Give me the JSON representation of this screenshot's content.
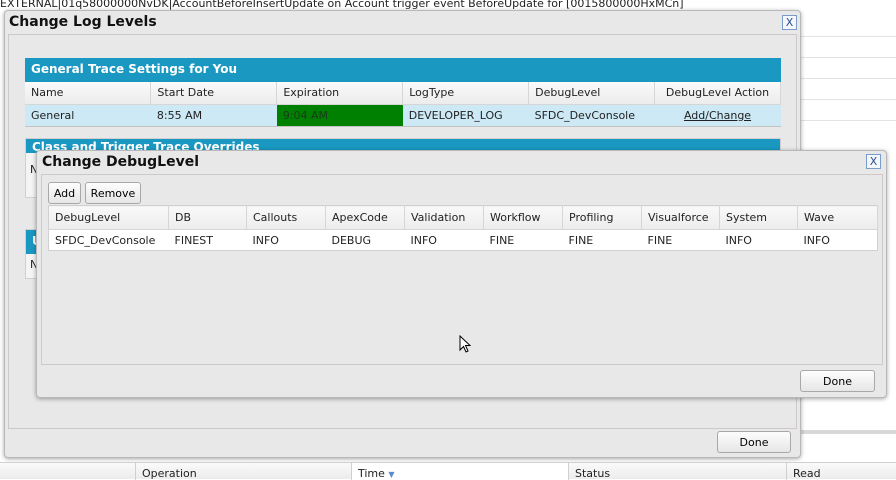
{
  "background": {
    "log_line": "EXTERNAL|01q58000000NvDK|AccountBeforeInsertUpdate on Account trigger event BeforeUpdate for [0015800000HxMCn]",
    "bottom_columns": [
      "Operation",
      "Time",
      "Status",
      "Read"
    ],
    "sort_icon": "sort-down-arrow-icon"
  },
  "log_dialog": {
    "title": "Change Log Levels",
    "close": "X",
    "general": {
      "title": "General Trace Settings for You",
      "columns": [
        "Name",
        "Start Date",
        "Expiration",
        "LogType",
        "DebugLevel",
        "DebugLevel Action"
      ],
      "row": {
        "name": "General",
        "start": "8:55 AM",
        "expiration": "9:04 AM",
        "logtype": "DEVELOPER_LOG",
        "debuglevel": "SFDC_DevConsole",
        "action": "Add/Change"
      },
      "expiration_color": "#008000"
    },
    "class_section_title": "Class and Trigger Trace Overrides",
    "class_row_first": "N",
    "user_section_title": "U",
    "user_row_first": "N",
    "done": "Done"
  },
  "debug_dialog": {
    "title": "Change DebugLevel",
    "close": "X",
    "add": "Add",
    "remove": "Remove",
    "columns": [
      "DebugLevel",
      "DB",
      "Callouts",
      "ApexCode",
      "Validation",
      "Workflow",
      "Profiling",
      "Visualforce",
      "System",
      "Wave"
    ],
    "row": [
      "SFDC_DevConsole",
      "FINEST",
      "INFO",
      "DEBUG",
      "INFO",
      "FINE",
      "FINE",
      "FINE",
      "INFO",
      "INFO"
    ],
    "done": "Done"
  },
  "colors": {
    "section_bar": "#1a98c2",
    "selected_row": "#cde9f5"
  }
}
